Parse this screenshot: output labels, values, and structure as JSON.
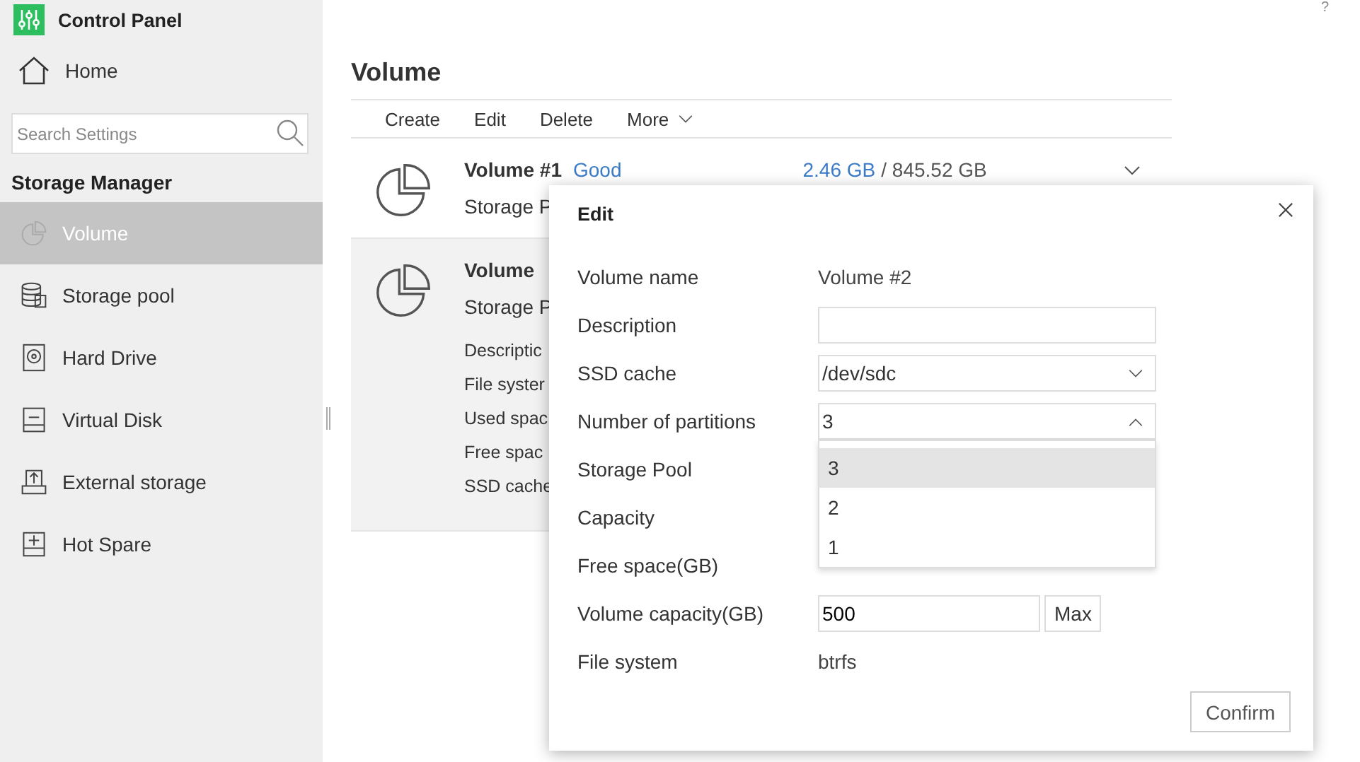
{
  "sidebar": {
    "title": "Control Panel",
    "home": "Home",
    "search": {
      "placeholder": "Search Settings"
    },
    "section": "Storage Manager",
    "nav": [
      {
        "label": "Volume",
        "selected": true
      },
      {
        "label": "Storage pool",
        "selected": false
      },
      {
        "label": "Hard Drive",
        "selected": false
      },
      {
        "label": "Virtual Disk",
        "selected": false
      },
      {
        "label": "External storage",
        "selected": false
      },
      {
        "label": "Hot Spare",
        "selected": false
      }
    ]
  },
  "help": "?",
  "page": {
    "title": "Volume",
    "toolbar": [
      {
        "label": "Create",
        "dropdown": false
      },
      {
        "label": "Edit",
        "dropdown": false
      },
      {
        "label": "Delete",
        "dropdown": false
      },
      {
        "label": "More",
        "dropdown": true
      }
    ],
    "volumes": [
      {
        "name": "Volume #1",
        "status": "Good",
        "used": "2.46 GB",
        "total": "/ 845.52 GB",
        "selected": false,
        "lines": [
          "Storage P"
        ]
      },
      {
        "name": "Volume",
        "selected": true,
        "lines": [
          "Storage P"
        ],
        "details": [
          "Descriptic",
          "File syster",
          "Used spac",
          "Free spac",
          "SSD cache"
        ]
      }
    ]
  },
  "dialog": {
    "title": "Edit",
    "fields": [
      {
        "label": "Volume name",
        "kind": "text",
        "value": "Volume #2"
      },
      {
        "label": "Description",
        "kind": "input"
      },
      {
        "label": "SSD cache",
        "kind": "select",
        "value": "/dev/sdc",
        "expanded": false
      },
      {
        "label": "Number of partitions",
        "kind": "select",
        "value": "3",
        "expanded": true,
        "options": [
          {
            "label": "3",
            "selected": true
          },
          {
            "label": "2",
            "selected": false
          },
          {
            "label": "1",
            "selected": false
          }
        ]
      },
      {
        "label": "Storage Pool",
        "kind": "label"
      },
      {
        "label": "Capacity",
        "kind": "label"
      },
      {
        "label": "Free space(GB)",
        "kind": "label"
      },
      {
        "label": "Volume capacity(GB)",
        "kind": "input_max",
        "value": "500",
        "button": "Max"
      },
      {
        "label": "File system",
        "kind": "text",
        "value": "btrfs"
      }
    ],
    "confirm": "Confirm"
  }
}
